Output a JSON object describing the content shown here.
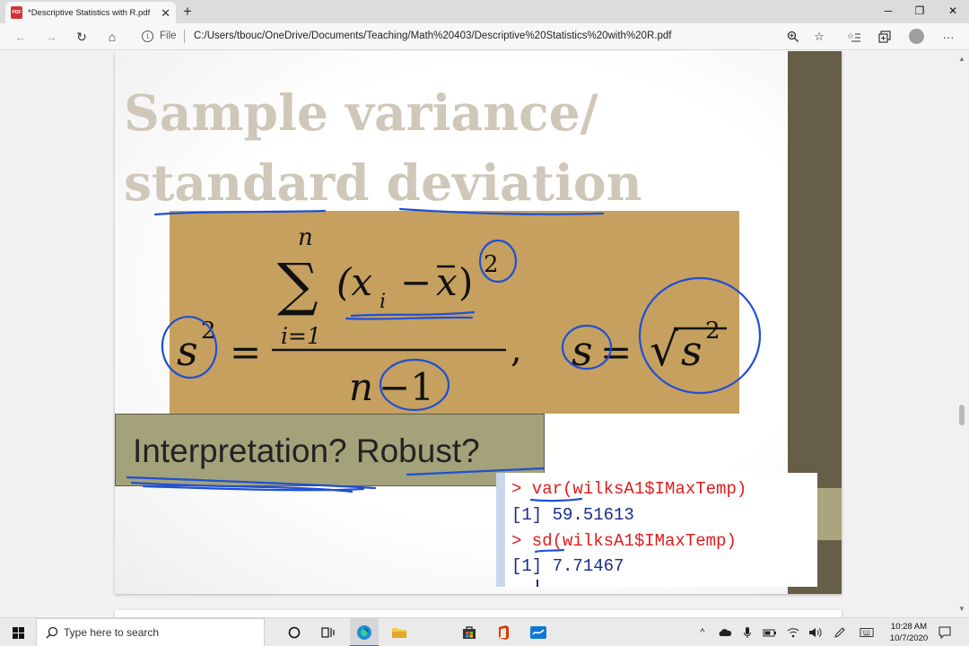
{
  "browser": {
    "tab_title": "*Descriptive Statistics with R.pdf",
    "tab_close": "✕",
    "new_tab": "+",
    "window_controls": [
      "─",
      "❐",
      "✕"
    ],
    "nav": {
      "back": "←",
      "forward": "→",
      "refresh": "↻",
      "home": "⌂"
    },
    "file_label": "File",
    "url": "C:/Users/tbouc/OneDrive/Documents/Teaching/Math%20403/Descriptive%20Statistics%20with%20R.pdf",
    "toolbar_icons": [
      "zoom-icon",
      "favorite-star-icon",
      "favorites-list-icon",
      "collections-icon",
      "profile-avatar",
      "more-menu-icon"
    ],
    "more": "···"
  },
  "slide": {
    "title_line1": "Sample variance/",
    "title_line2": "standard deviation",
    "formula": {
      "lhs": "s",
      "exponent": "2",
      "equals": "=",
      "sum_upper": "n",
      "sum_lower": "i=1",
      "sum_symbol": "∑",
      "numerator": "(x",
      "subscript_i": "i",
      "minus": "−",
      "xbar": "x",
      "close_paren": ")",
      "denominator_n": "n",
      "denominator_minus_one": "−1",
      "comma": ",",
      "s_rhs": "s",
      "sqrt": "√",
      "s_sq": "s"
    },
    "interpretation": "Interpretation? Robust?",
    "console": [
      {
        "kind": "cmd",
        "text": "> var(wilksA1$IMaxTemp)"
      },
      {
        "kind": "out",
        "text": "[1] 59.51613"
      },
      {
        "kind": "cmd",
        "text": "> sd(wilksA1$IMaxTemp)"
      },
      {
        "kind": "out",
        "text": "[1] 7.71467"
      }
    ]
  },
  "taskbar": {
    "search_placeholder": "Type here to search",
    "pinned": [
      "cortana-icon",
      "task-view-icon",
      "edge-icon",
      "file-explorer-icon",
      "store-icon",
      "office-icon",
      "whiteboard-icon"
    ],
    "clock_time": "10:28 AM",
    "clock_date": "10/7/2020"
  },
  "colors": {
    "title_text": "#cfc7b9",
    "formula_bg": "#c6a05e",
    "interp_bg": "#a3a27a",
    "side_band": "#675e48",
    "ink_annotation": "#1f4fd6",
    "console_cmd": "#e01b1b",
    "console_out": "#1a2a8c"
  }
}
